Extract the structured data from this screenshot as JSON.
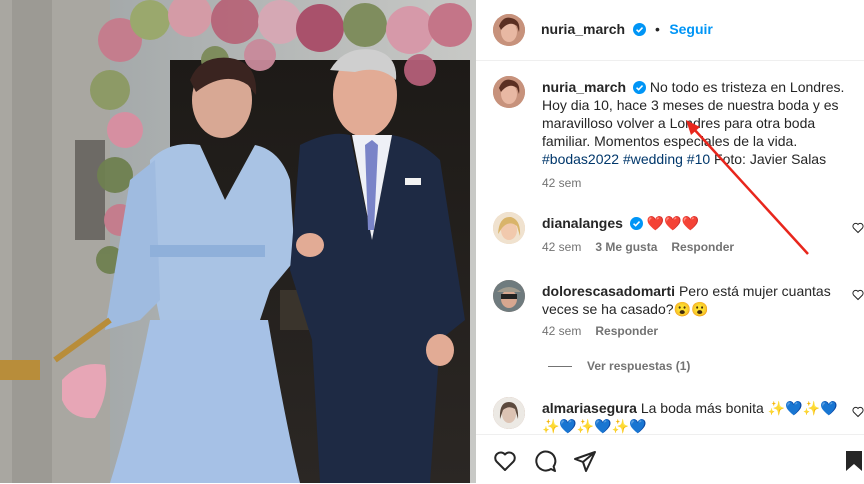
{
  "post": {
    "author": "nuria_march",
    "follow_label": "Seguir",
    "caption_author": "nuria_march",
    "caption_lines": [
      "No todo es tristeza en Londres.",
      "Hoy dia 10, hace 3 meses de nuestra boda y es",
      "maravilloso volver a Londres para otra boda",
      "familiar. Momentos especiales de la vida."
    ],
    "caption_hashtags": "#bodas2022 #wedding #10",
    "caption_tail": " Foto: Javier Salas",
    "caption_time": "42 sem"
  },
  "comments": [
    {
      "user": "dianalanges",
      "text": "❤️❤️❤️",
      "time": "42 sem",
      "likes": "3 Me gusta",
      "reply": "Responder"
    },
    {
      "user": "dolorescasadomarti",
      "text_line1": "Pero está mujer cuantas",
      "text_line2": "veces se ha casado?😮😮",
      "time": "42 sem",
      "reply": "Responder",
      "view_replies": "Ver respuestas (1)"
    },
    {
      "user": "almariasegura",
      "text_line1": "La boda más bonita ✨💙✨💙",
      "text_line2": "✨💙✨💙✨💙"
    }
  ],
  "colors": {
    "accent": "#0095f6",
    "verified": "#0095f6",
    "annotation_arrow": "#e8261c"
  },
  "icons": [
    "heart-icon",
    "comment-icon",
    "share-icon",
    "bookmark-icon",
    "verified-icon"
  ]
}
